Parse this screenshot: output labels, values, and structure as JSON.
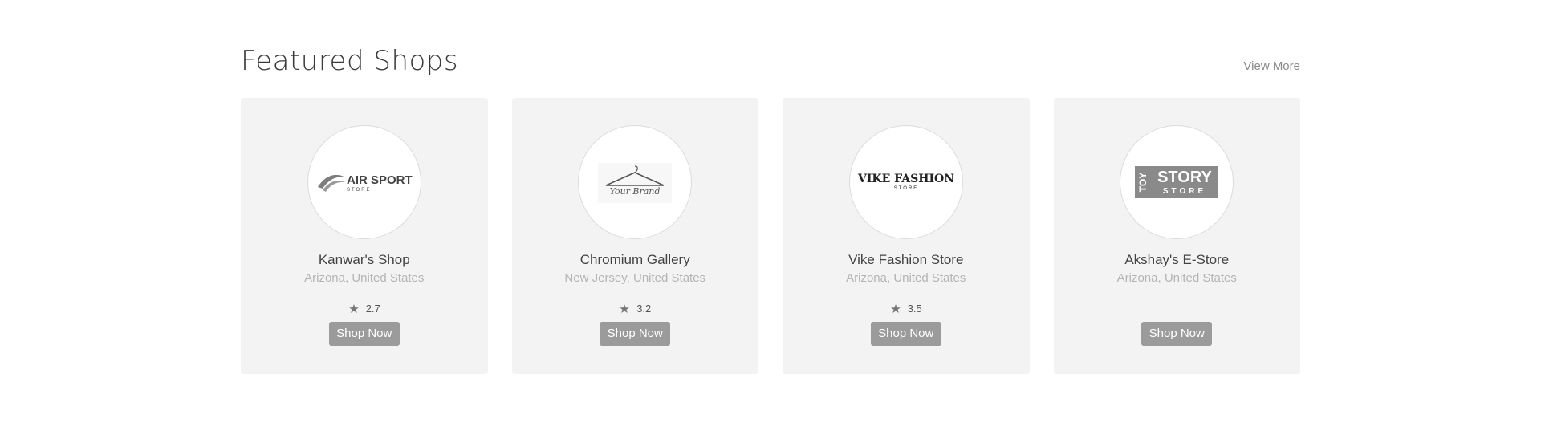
{
  "section": {
    "title": "Featured Shops",
    "view_more": "View More"
  },
  "shops": [
    {
      "name": "Kanwar's Shop",
      "location": "Arizona, United States",
      "rating": "2.7",
      "button": "Shop Now",
      "logo": {
        "line1": "AIR SPORT",
        "line2": "STORE"
      }
    },
    {
      "name": "Chromium Gallery",
      "location": "New Jersey, United States",
      "rating": "3.2",
      "button": "Shop Now",
      "logo": {
        "line1": "Your Brand"
      }
    },
    {
      "name": "Vike Fashion Store",
      "location": "Arizona, United States",
      "rating": "3.5",
      "button": "Shop Now",
      "logo": {
        "line1": "VIKE FASHION",
        "line2": "STORE"
      }
    },
    {
      "name": "Akshay's E-Store",
      "location": "Arizona, United States",
      "rating": "",
      "button": "Shop Now",
      "logo": {
        "side": "TOY",
        "line1": "STORY",
        "line2": "STORE"
      }
    }
  ],
  "colors": {
    "card_bg": "#f3f3f3",
    "button_bg": "#9b9b9b",
    "muted_text": "#b4b4b4"
  }
}
